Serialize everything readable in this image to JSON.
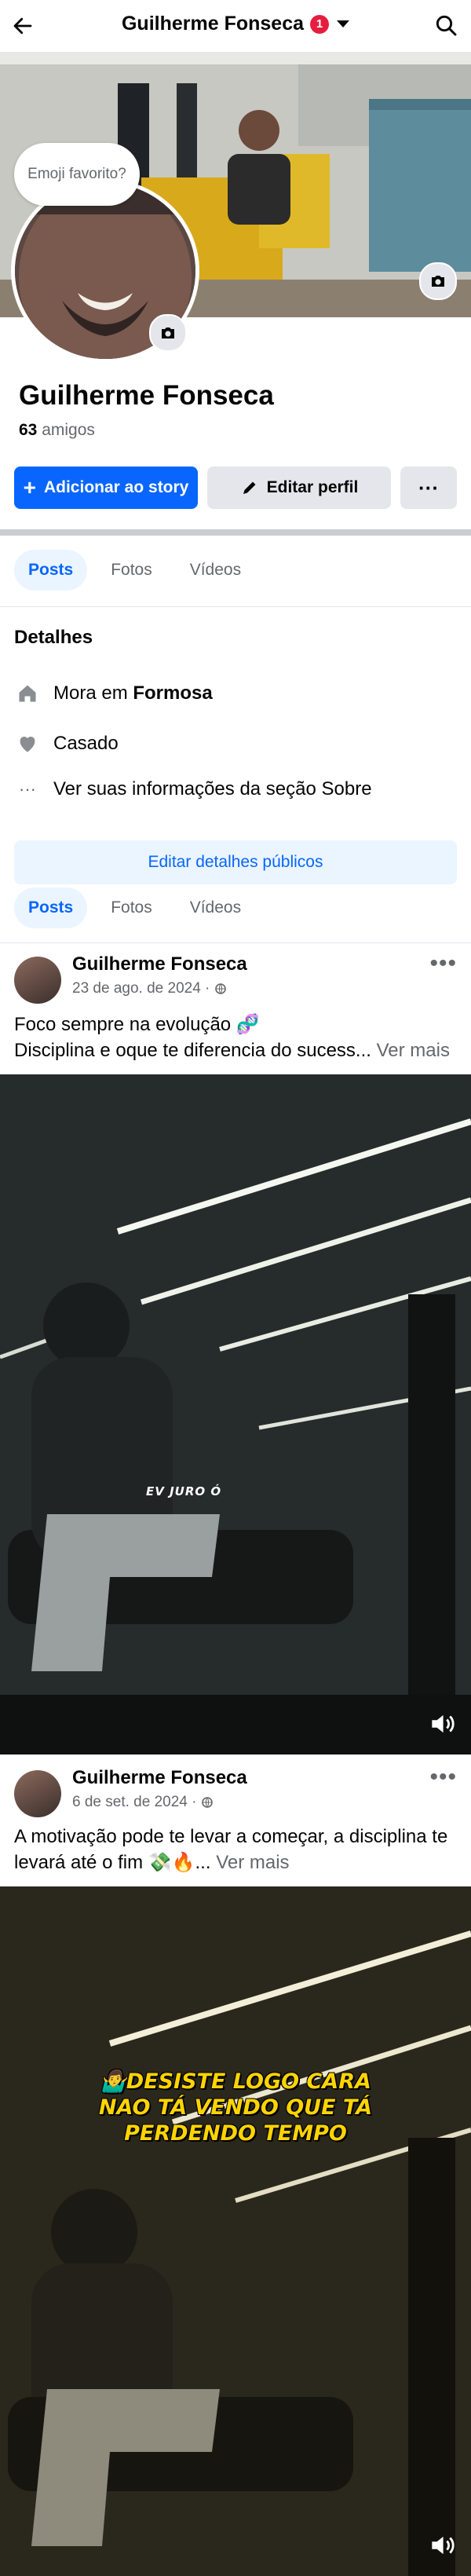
{
  "header": {
    "title": "Guilherme Fonseca",
    "badge": "1"
  },
  "cover": {
    "bubble_text": "Emoji favorito?"
  },
  "profile": {
    "name": "Guilherme Fonseca",
    "friends_count": "63",
    "friends_label": "amigos"
  },
  "actions": {
    "add_story": "Adicionar ao story",
    "edit_profile": "Editar perfil",
    "more": "···"
  },
  "tabs": [
    "Posts",
    "Fotos",
    "Vídeos"
  ],
  "details": {
    "title": "Detalhes",
    "lives_prefix": "Mora em",
    "lives_city": "Formosa",
    "relationship": "Casado",
    "about_link": "Ver suas informações da seção Sobre",
    "edit_button": "Editar detalhes públicos"
  },
  "posts": [
    {
      "author": "Guilherme Fonseca",
      "date": "23 de ago. de 2024 ·",
      "line1": "Foco sempre na evolução 🧬",
      "line2": "Disciplina e oque te diferencia do sucess...",
      "more": "Ver mais",
      "overlay": "EV JURO Ó"
    },
    {
      "author": "Guilherme Fonseca",
      "date": "6 de set. de 2024 ·",
      "line1": "A motivação pode te levar a começar, a disciplina te",
      "line2": "levará até o fim 💸🔥...",
      "more": "Ver mais",
      "caption": "🤷‍♂️DESISTE LOGO CARA NAO TÁ VENDO QUE TÁ PERDENDO TEMPO"
    }
  ],
  "colors": {
    "primary": "#0866ff",
    "badge": "#e41e3f",
    "secondary_bg": "#e4e6eb",
    "light_blue": "#ebf5ff"
  }
}
